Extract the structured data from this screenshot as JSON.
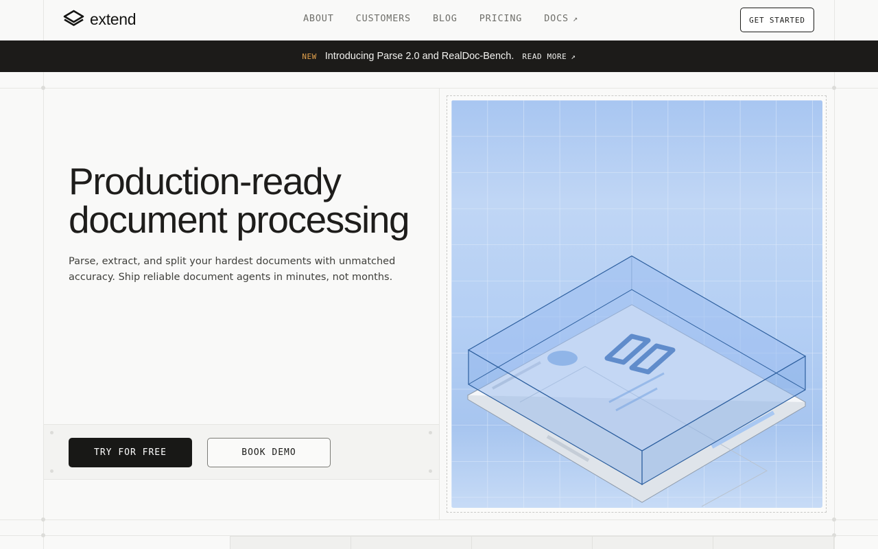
{
  "brand": {
    "name": "extend"
  },
  "nav": {
    "items": [
      {
        "label": "ABOUT"
      },
      {
        "label": "CUSTOMERS"
      },
      {
        "label": "BLOG"
      },
      {
        "label": "PRICING"
      },
      {
        "label": "DOCS",
        "external": true
      }
    ],
    "cta_label": "GET STARTED"
  },
  "announcement": {
    "badge": "NEW",
    "text": "Introducing Parse 2.0 and RealDoc-Bench.",
    "link_label": "READ MORE"
  },
  "hero": {
    "title_line1": "Production-ready",
    "title_line2": "document processing",
    "subtitle": "Parse, extract, and split your hardest documents with unmatched accuracy. Ship reliable document agents in minutes, not months.",
    "primary_button": "TRY FOR FREE",
    "secondary_button": "BOOK DEMO"
  },
  "colors": {
    "accent_dark": "#1c1b19",
    "badge": "#e2a14c",
    "illustration_blue": "#a9c8f2",
    "illustration_line": "#2d5f9e"
  },
  "icons": {
    "logo": "layers-logo-icon",
    "external": "arrow-up-right-icon"
  }
}
